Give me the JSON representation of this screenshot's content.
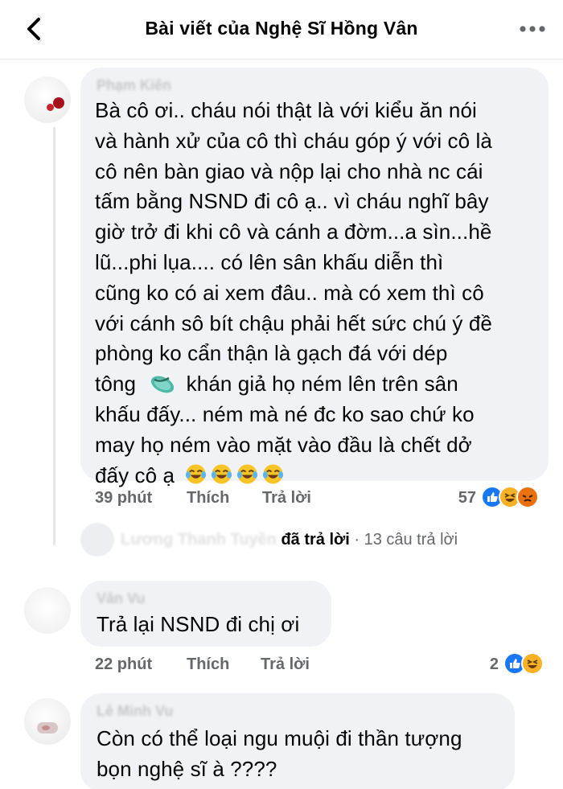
{
  "header": {
    "title": "Bài viết của Nghệ Sĩ Hồng Vân"
  },
  "comments": [
    {
      "author": "Phạm Kiên",
      "lines": [
        "Bà cô ơi.. cháu nói thật là với kiểu ăn nói",
        "và hành xử của cô thì cháu góp ý với cô là",
        "cô nên bàn giao và nộp lại cho nhà nc cái",
        "tấm bằng NSND đi cô ạ.. vì cháu nghĩ bây",
        "giờ trở đi khi cô và cánh a đờm...a sìn...hề",
        "lũ...phi lụa.... có lên sân khấu diễn thì",
        "cũng ko có ai xem đâu.. mà có xem thì cô",
        "với cánh sô bít chậu phải hết sức chú ý đề",
        "phòng ko cẩn thận là gạch đá với dép",
        "tông",
        "khán giả họ ném lên trên sân",
        "khấu đấy... ném mà né đc ko sao chứ ko",
        "may họ ném vào mặt vào đầu là chết dở",
        "đấy cô ạ"
      ],
      "time": "39 phút",
      "like_label": "Thích",
      "reply_label": "Trả lời",
      "reaction_count": "57",
      "reactions": [
        "like-icon",
        "haha-icon",
        "angry-icon"
      ],
      "reply_summary": {
        "name": "Lương Thanh Tuyền",
        "text": "đã trả lời",
        "count": "· 13 câu trả lời"
      }
    },
    {
      "author": "Văn Vu",
      "lines": [
        "Trả lại NSND đi chị ơi"
      ],
      "time": "22 phút",
      "like_label": "Thích",
      "reply_label": "Trả lời",
      "reaction_count": "2",
      "reactions": [
        "like-icon",
        "haha-icon"
      ]
    },
    {
      "author": "Lê Minh Vu",
      "lines": [
        "Còn có thể loại ngu muội đi thần tượng",
        "bọn nghệ sĩ à ????"
      ]
    }
  ],
  "colors": {
    "bubble": "#f0f2f5",
    "meta_text": "#65676b",
    "like_blue": "#1877f2",
    "haha_yellow": "#f7b125",
    "angry_orange": "#e9710f"
  }
}
